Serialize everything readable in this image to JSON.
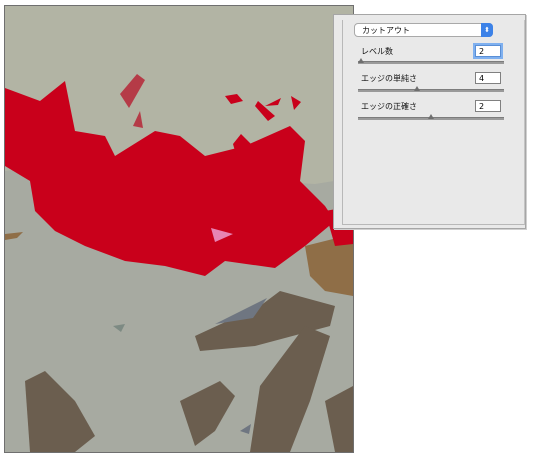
{
  "filter_panel": {
    "filter_name": "カットアウト",
    "controls": [
      {
        "label": "レベル数",
        "value": "2",
        "slider_fraction": 0.0
      },
      {
        "label": "エッジの単純さ",
        "value": "4",
        "slider_fraction": 0.4
      },
      {
        "label": "エッジの正確さ",
        "value": "2",
        "slider_fraction": 0.5
      }
    ]
  },
  "preview": {
    "colors": {
      "background": "#b2b4a4",
      "light_gray": "#a7aaa1",
      "red": "#c9001b",
      "dark_red": "#b53b47",
      "brown": "#6b5e4f",
      "tan": "#8f6e47",
      "pink": "#e784b4",
      "slate": "#6f7681"
    }
  },
  "icons": {
    "select_arrows": "updown-chevron-icon"
  }
}
